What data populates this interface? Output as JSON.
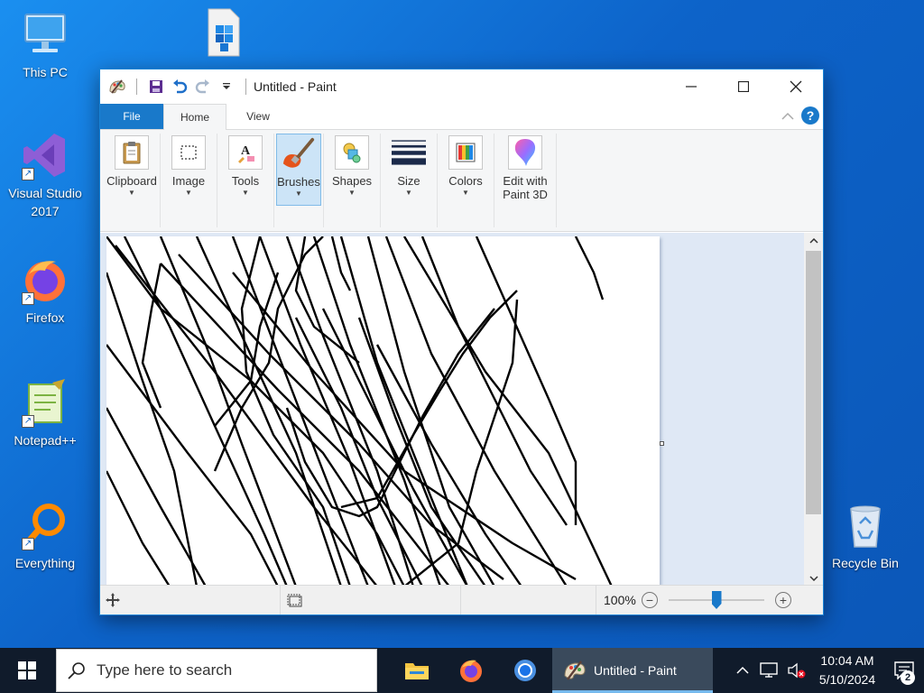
{
  "desktop": {
    "icons": [
      {
        "label": "This PC",
        "icon": "computer-icon"
      },
      {
        "label": "Visual Studio 2017",
        "icon": "visual-studio-icon"
      },
      {
        "label": "Firefox",
        "icon": "firefox-icon"
      },
      {
        "label": "Notepad++",
        "icon": "notepadpp-icon"
      },
      {
        "label": "Everything",
        "icon": "everything-search-icon"
      },
      {
        "label": "Recycle Bin",
        "icon": "recycle-bin-icon"
      },
      {
        "label": "",
        "icon": "registry-cubes-icon"
      }
    ]
  },
  "paint": {
    "title": "Untitled - Paint",
    "quick_access": [
      "paint-menu-icon",
      "save-icon",
      "undo-icon",
      "redo-icon",
      "customize-qat-icon"
    ],
    "window_controls": [
      "minimize",
      "maximize",
      "close"
    ],
    "tabs": [
      "File",
      "Home",
      "View"
    ],
    "active_tab": "Home",
    "ribbon_groups": [
      {
        "label": "Clipboard",
        "icon": "clipboard-icon",
        "has_dropdown": true
      },
      {
        "label": "Image",
        "icon": "select-rectangle-icon",
        "has_dropdown": true
      },
      {
        "label": "Tools",
        "icon": "text-tool-icon",
        "has_dropdown": true
      },
      {
        "label": "Brushes",
        "icon": "brush-icon",
        "has_dropdown": true,
        "selected": true
      },
      {
        "label": "Shapes",
        "icon": "shapes-icon",
        "has_dropdown": true
      },
      {
        "label": "Size",
        "icon": "line-size-icon",
        "has_dropdown": true
      },
      {
        "label": "Colors",
        "icon": "color-palette-icon",
        "has_dropdown": true
      },
      {
        "label": "Edit with Paint 3D",
        "line1": "Edit with",
        "line2": "Paint 3D",
        "icon": "paint3d-icon",
        "has_dropdown": false
      }
    ],
    "status": {
      "zoom": "100%",
      "zoom_level": 100,
      "zoom_min": 12.5,
      "zoom_max": 800
    }
  },
  "taskbar": {
    "search_placeholder": "Type here to search",
    "pinned": [
      "file-explorer-icon",
      "firefox-icon",
      "chrome-icon"
    ],
    "active_app": "Untitled - Paint",
    "clock_time": "10:04 AM",
    "clock_date": "5/10/2024",
    "notification_count": "2"
  },
  "colors": {
    "accent": "#1979ca",
    "desktop_bg": "#0d63c9",
    "taskbar_bg": "#101b2b"
  }
}
